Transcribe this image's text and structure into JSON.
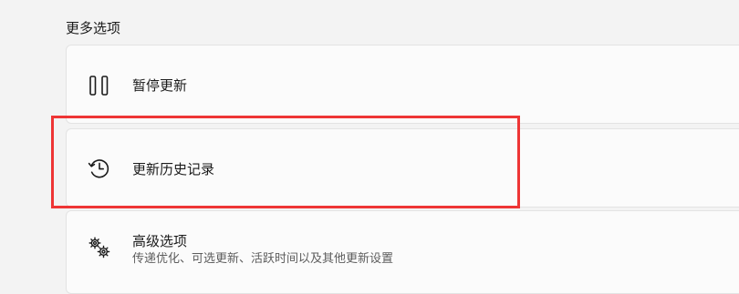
{
  "section": {
    "header": "更多选项"
  },
  "options": {
    "pause": {
      "title": "暂停更新",
      "icon": "pause-icon"
    },
    "history": {
      "title": "更新历史记录",
      "icon": "history-icon"
    },
    "advanced": {
      "title": "高级选项",
      "subtitle": "传递优化、可选更新、活跃时间以及其他更新设置",
      "icon": "gears-icon"
    }
  },
  "annotation": {
    "highlight_color": "#ee3535"
  },
  "colors": {
    "background": "#f3f3f3",
    "card": "#fbfbfb",
    "card_border": "#e3e3e3",
    "text_primary": "#1b1b1b",
    "text_secondary": "#5d5d5d"
  }
}
